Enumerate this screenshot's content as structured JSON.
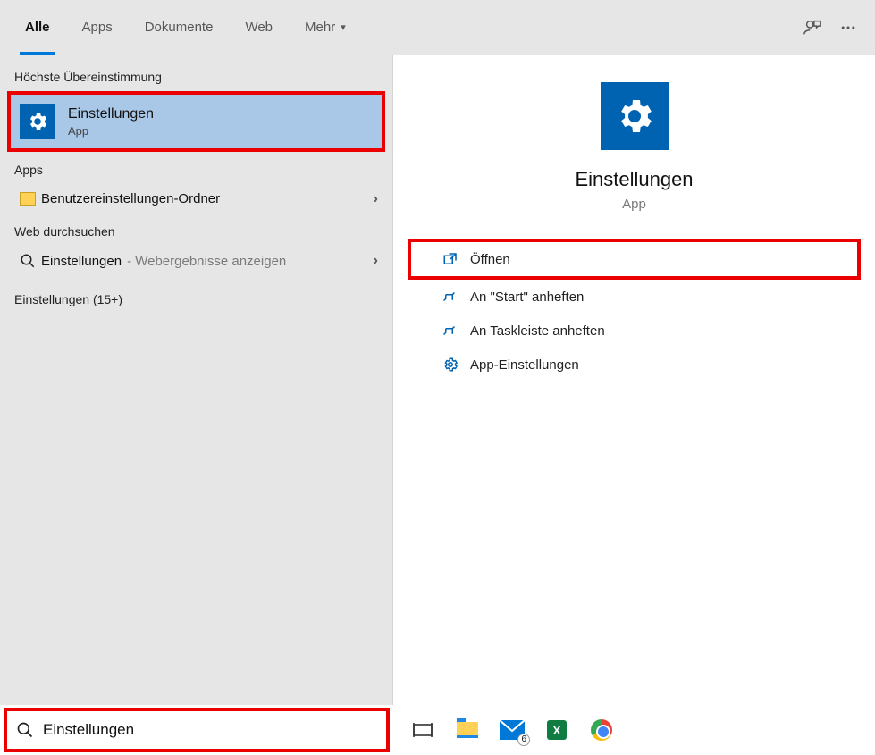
{
  "tabs": {
    "all": "Alle",
    "apps": "Apps",
    "documents": "Dokumente",
    "web": "Web",
    "more": "Mehr"
  },
  "left": {
    "best_match_label": "Höchste Übereinstimmung",
    "best_match": {
      "title": "Einstellungen",
      "subtitle": "App"
    },
    "apps_label": "Apps",
    "apps_item": "Benutzereinstellungen-Ordner",
    "web_label": "Web durchsuchen",
    "web_item": "Einstellungen",
    "web_item_sub": "- Webergebnisse anzeigen",
    "settings_more": "Einstellungen (15+)"
  },
  "detail": {
    "title": "Einstellungen",
    "subtitle": "App",
    "actions": {
      "open": "Öffnen",
      "pin_start": "An \"Start\" anheften",
      "pin_taskbar": "An Taskleiste anheften",
      "app_settings": "App-Einstellungen"
    }
  },
  "search": {
    "value": "Einstellungen"
  },
  "mail_badge": "6"
}
